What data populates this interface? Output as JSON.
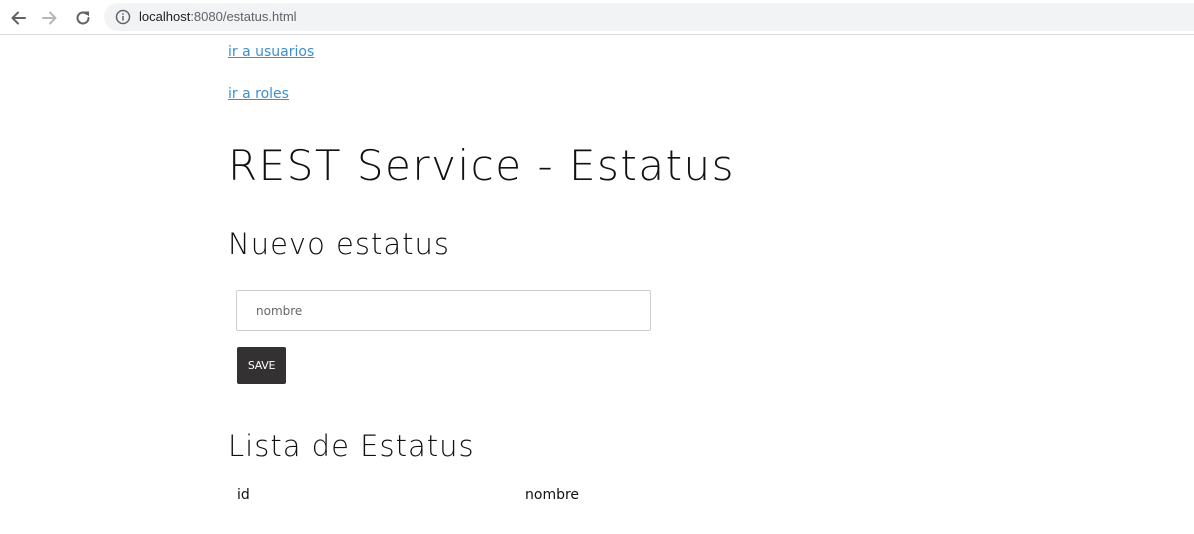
{
  "browser": {
    "url_host": "localhost",
    "url_path": ":8080/estatus.html"
  },
  "links": {
    "usuarios": "ir a usuarios",
    "roles": "ir a roles"
  },
  "page_title": "REST Service - Estatus",
  "new_section": {
    "title": "Nuevo estatus",
    "input_placeholder": "nombre",
    "input_value": "",
    "save_label": "SAVE"
  },
  "list_section": {
    "title": "Lista de Estatus",
    "columns": [
      "id",
      "nombre"
    ],
    "rows": []
  },
  "colors": {
    "link": "#3a8fd2",
    "button_bg": "#333131",
    "omnibox_bg": "#f1f3f4"
  }
}
